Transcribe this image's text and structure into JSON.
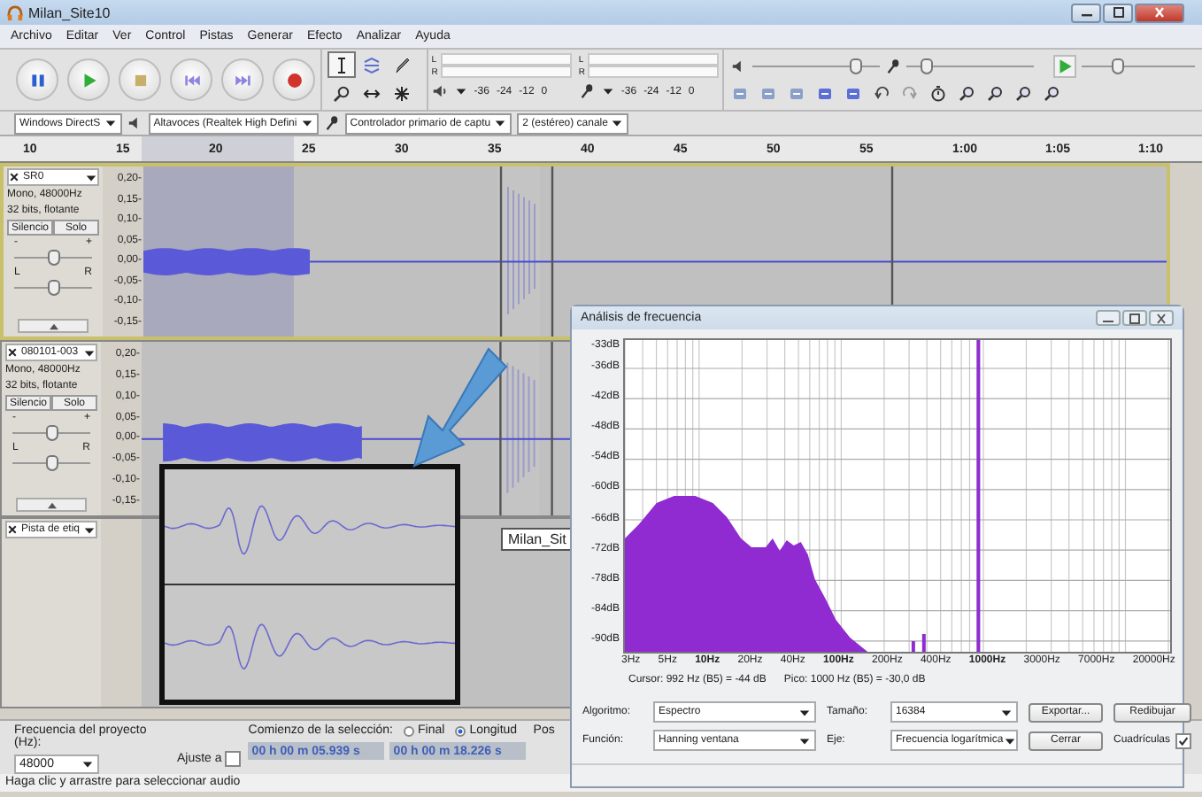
{
  "window": {
    "title": "Milan_Site10"
  },
  "menu": [
    {
      "label": "Archivo"
    },
    {
      "label": "Editar"
    },
    {
      "label": "Ver"
    },
    {
      "label": "Control"
    },
    {
      "label": "Pistas"
    },
    {
      "label": "Generar"
    },
    {
      "label": "Efecto"
    },
    {
      "label": "Analizar"
    },
    {
      "label": "Ayuda"
    }
  ],
  "transport": [
    {
      "kind": "pause"
    },
    {
      "kind": "play"
    },
    {
      "kind": "stop"
    },
    {
      "kind": "skip-start"
    },
    {
      "kind": "skip-end"
    },
    {
      "kind": "record"
    }
  ],
  "tools": [
    {
      "kind": "select",
      "selected": true
    },
    {
      "kind": "envelope",
      "selected": false
    },
    {
      "kind": "draw",
      "selected": false
    },
    {
      "kind": "zoom",
      "selected": false
    },
    {
      "kind": "timeshift",
      "selected": false
    },
    {
      "kind": "multi",
      "selected": false
    }
  ],
  "meters": [
    {
      "kind": "output",
      "channels": [
        "L",
        "R"
      ],
      "scale": [
        "-36",
        "-24",
        "-12",
        "0"
      ]
    },
    {
      "kind": "input",
      "channels": [
        "L",
        "R"
      ],
      "scale": [
        "-36",
        "-24",
        "-12",
        "0"
      ]
    }
  ],
  "mixer": {
    "output": {
      "level": 0.85
    },
    "input": {
      "level": 0.12
    }
  },
  "play_at_speed": {
    "level": 0.3
  },
  "devices": [
    {
      "value": "Windows DirectS"
    },
    {
      "value": "Altavoces (Realtek High Defini"
    },
    {
      "value": "Controlador primario de captu"
    },
    {
      "value": "2 (estéreo) canale"
    }
  ],
  "ruler": [
    "10",
    "15",
    "20",
    "25",
    "30",
    "35",
    "40",
    "45",
    "50",
    "55",
    "1:00",
    "1:05",
    "1:10"
  ],
  "tracks": [
    {
      "kind": "audio",
      "name": "SR0",
      "selected": true,
      "info": [
        "Mono, 48000Hz",
        "32 bits, flotante"
      ],
      "mute": "Silencio",
      "solo": "Solo",
      "gain_marks": [
        "-",
        "+"
      ],
      "pan_marks": [
        "L",
        "R"
      ],
      "gain": {
        "level": 0.5
      },
      "pan": {
        "level": 0.5
      },
      "scale": [
        "0,20-",
        "0,15-",
        "0,10-",
        "0,05-",
        "0,00-",
        "-0,05-",
        "-0,10-",
        "-0,15-"
      ]
    },
    {
      "kind": "audio",
      "name": "080101-003",
      "selected": false,
      "info": [
        "Mono, 48000Hz",
        "32 bits, flotante"
      ],
      "mute": "Silencio",
      "solo": "Solo",
      "gain_marks": [
        "-",
        "+"
      ],
      "pan_marks": [
        "L",
        "R"
      ],
      "gain": {
        "level": 0.5
      },
      "pan": {
        "level": 0.5
      },
      "scale": [
        "0,20-",
        "0,15-",
        "0,10-",
        "0,05-",
        "0,00-",
        "-0,05-",
        "-0,10-",
        "-0,15-"
      ]
    },
    {
      "kind": "label",
      "name": "Pista de etiq",
      "selected": false,
      "labels": [
        "Milan_Sit"
      ]
    }
  ],
  "frequency_dialog": {
    "title": "Análisis de frecuencia",
    "y_ticks": [
      "-33dB",
      "-36dB",
      "-42dB",
      "-48dB",
      "-54dB",
      "-60dB",
      "-66dB",
      "-72dB",
      "-78dB",
      "-84dB",
      "-90dB"
    ],
    "x_ticks": [
      {
        "label": "3Hz",
        "bold": false
      },
      {
        "label": "5Hz",
        "bold": false
      },
      {
        "label": "10Hz",
        "bold": true
      },
      {
        "label": "20Hz",
        "bold": false
      },
      {
        "label": "40Hz",
        "bold": false
      },
      {
        "label": "100Hz",
        "bold": true
      },
      {
        "label": "200Hz",
        "bold": false
      },
      {
        "label": "400Hz",
        "bold": false
      },
      {
        "label": "1000Hz",
        "bold": true
      },
      {
        "label": "3000Hz",
        "bold": false
      },
      {
        "label": "7000Hz",
        "bold": false
      },
      {
        "label": "20000Hz",
        "bold": false
      }
    ],
    "cursor": "Cursor: 992 Hz (B5) = -44 dB",
    "peak": "Pico: 1000 Hz (B5) = -30,0 dB",
    "fields": [
      {
        "label": "Algoritmo:",
        "value": "Espectro"
      },
      {
        "label": "Tamaño:",
        "value": "16384"
      },
      {
        "label": "Función:",
        "value": "Hanning ventana"
      },
      {
        "label": "Eje:",
        "value": "Frecuencia logarítmica"
      }
    ],
    "buttons": [
      "Exportar...",
      "Redibujar",
      "Cerrar"
    ],
    "grid": {
      "label": "Cuadrículas",
      "checked": true
    }
  },
  "selection_bar": {
    "rate_label": "Frecuencia del proyecto (Hz):",
    "rate": "48000",
    "snap_label": "Ajuste a",
    "snap": false,
    "start_label": "Comienzo de la selección:",
    "end_modes": [
      {
        "label": "Final",
        "selected": false
      },
      {
        "label": "Longitud",
        "selected": true
      }
    ],
    "start": "00 h 00 m 05.939 s",
    "length": "00 h 00 m 18.226 s",
    "position_label": "Pos"
  },
  "status_bar": "Haga clic y arrastre para seleccionar audio"
}
